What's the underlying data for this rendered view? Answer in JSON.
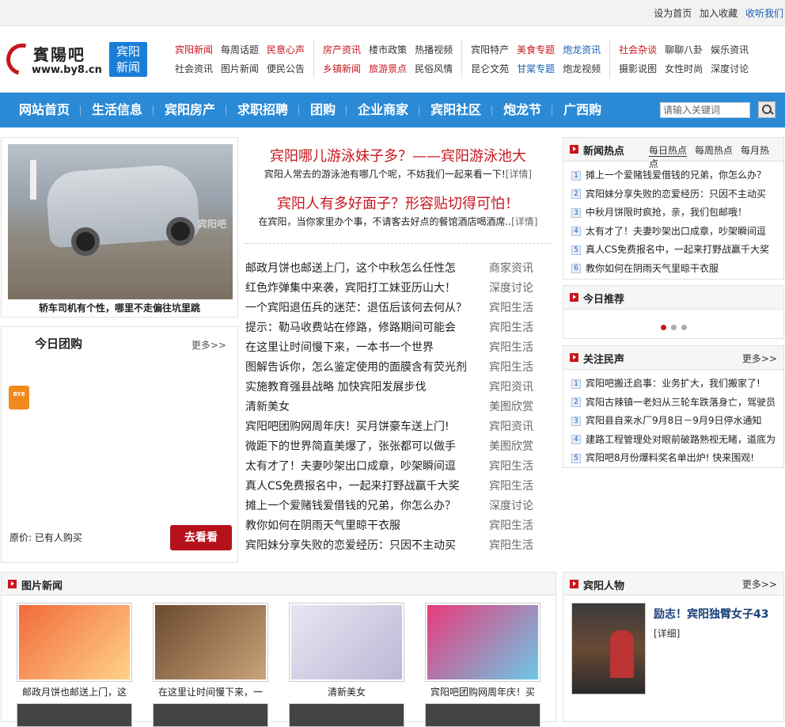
{
  "topbar": {
    "links": [
      "设为首页",
      "加入收藏",
      "收听我们"
    ]
  },
  "logo": {
    "name": "賓陽吧",
    "url": "www.by8.cn"
  },
  "badge": {
    "line1": "宾阳",
    "line2": "新闻"
  },
  "header_nav": {
    "row1": [
      [
        "宾阳新闻",
        "每周话题",
        "民意心声"
      ],
      [
        "房产资讯",
        "楼市政策",
        "热播视频"
      ],
      [
        "宾阳特产",
        "美食专题",
        "炮龙资讯"
      ],
      [
        "社会杂谈",
        "聊聊八卦",
        "娱乐资讯"
      ]
    ],
    "row2": [
      [
        "社会资讯",
        "图片新闻",
        "便民公告"
      ],
      [
        "乡镇新闻",
        "旅游景点",
        "民俗风情"
      ],
      [
        "昆仑文苑",
        "甘棠专题",
        "炮龙视频"
      ],
      [
        "摄影说图",
        "女性时尚",
        "深度讨论"
      ]
    ]
  },
  "main_nav": [
    "网站首页",
    "生活信息",
    "宾阳房产",
    "求职招聘",
    "团购",
    "企业商家",
    "宾阳社区",
    "炮龙节",
    "广西购"
  ],
  "search": {
    "placeholder": "请输入关键词"
  },
  "photo": {
    "caption": "轿车司机有个性，哪里不走偏往坑里跳",
    "watermark": "宾阳吧"
  },
  "tuan": {
    "title": "今日团购",
    "more": "更多>>",
    "icon": "BY8",
    "price": "原价:  已有人购买",
    "button": "去看看"
  },
  "headlines": [
    {
      "title": "宾阳哪儿游泳妹子多？——宾阳游泳池大",
      "desc": "宾阳人常去的游泳池有哪几个呢，不妨我们一起来看一下!",
      "more": "[详情]"
    },
    {
      "title": "宾阳人有多好面子？形容贴切得可怕！",
      "desc": "在宾阳，当你家里办个事，不请客去好点的餐馆酒店喝酒席..",
      "more": "[详情]"
    }
  ],
  "news_list": [
    {
      "title": "邮政月饼也邮送上门，这个中秋怎么任性怎",
      "cat": "商家资讯"
    },
    {
      "title": "红色炸弹集中来袭，宾阳打工妹亚历山大！",
      "cat": "深度讨论"
    },
    {
      "title": "一个宾阳退伍兵的迷茫：退伍后该何去何从？",
      "cat": "宾阳生活"
    },
    {
      "title": "提示：勒马收费站在修路，修路期间可能会",
      "cat": "宾阳生活"
    },
    {
      "title": "在这里让时间慢下来，一本书一个世界",
      "cat": "宾阳生活"
    },
    {
      "title": "图解告诉你，怎么鉴定使用的面膜含有荧光剂",
      "cat": "宾阳生活"
    },
    {
      "title": "实施教育强县战略 加快宾阳发展步伐",
      "cat": "宾阳资讯"
    },
    {
      "title": "清新美女",
      "cat": "美图欣赏"
    },
    {
      "title": "宾阳吧团购网周年庆！买月饼豪车送上门!",
      "cat": "宾阳资讯"
    },
    {
      "title": "微距下的世界简直美爆了，张张都可以做手",
      "cat": "美图欣赏"
    },
    {
      "title": "太有才了！夫妻吵架出口成章，吵架瞬间逗",
      "cat": "宾阳生活"
    },
    {
      "title": "真人CS免费报名中，一起来打野战赢千大奖",
      "cat": "宾阳生活"
    },
    {
      "title": "摊上一个爱赌钱爱借钱的兄弟，你怎么办？",
      "cat": "深度讨论"
    },
    {
      "title": "教你如何在阴雨天气里晾干衣服",
      "cat": "宾阳生活"
    },
    {
      "title": "宾阳妹分享失败的恋爱经历：只因不主动买",
      "cat": "宾阳生活"
    }
  ],
  "hot": {
    "title": "新闻热点",
    "tabs": [
      "每日热点",
      "每周热点",
      "每月热点"
    ],
    "items": [
      "摊上一个爱赌钱爱借钱的兄弟，你怎么办？",
      "宾阳妹分享失败的恋爱经历：只因不主动买",
      "中秋月饼限时疯抢，亲，我们包邮哦！",
      "太有才了！夫妻吵架出口成章，吵架瞬间逗",
      "真人CS免费报名中，一起来打野战赢千大奖",
      "教你如何在阴雨天气里晾干衣服"
    ]
  },
  "recommend": {
    "title": "今日推荐"
  },
  "voice": {
    "title": "关注民声",
    "more": "更多>>",
    "items": [
      "宾阳吧搬迁启事：业务扩大，我们搬家了!",
      "宾阳古辣镇一老妇从三轮车跌落身亡，驾驶员",
      "宾阳县自来水厂9月8日－9月9日停水通知",
      "建路工程管理处对眼前破路熟视无睹，道底为",
      "宾阳吧8月份爆料奖名单出炉! 快来围观!"
    ]
  },
  "picnews": {
    "title": "图片新闻",
    "items": [
      {
        "caption": "邮政月饼也邮送上门，这",
        "colors": [
          "#f26a3a",
          "#ffd28a"
        ]
      },
      {
        "caption": "在这里让时间慢下来，一",
        "colors": [
          "#6b4a2e",
          "#c9a37a"
        ]
      },
      {
        "caption": "清新美女",
        "colors": [
          "#e8e6f2",
          "#bdb7d6"
        ]
      },
      {
        "caption": "宾阳吧团购网周年庆！买",
        "colors": [
          "#e83a7a",
          "#6cc8e8"
        ]
      }
    ]
  },
  "person": {
    "title": "宾阳人物",
    "more": "更多>>",
    "headline": "励志！宾阳独臂女子43",
    "detail": "[详细]"
  }
}
